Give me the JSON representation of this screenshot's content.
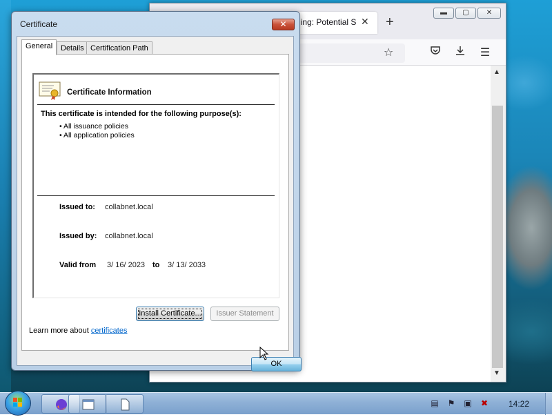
{
  "browser": {
    "tab_title": "ning: Potential S",
    "tab_close": "✕",
    "new_tab": "+",
    "window_controls": {
      "minimize": "▬",
      "maximize": "▢",
      "close": "✕"
    },
    "toolbar_icons": [
      "star-icon",
      "pocket-icon",
      "download-icon",
      "menu-icon"
    ]
  },
  "dialog": {
    "title": "Certificate",
    "close_label": "✕",
    "tabs": [
      {
        "label": "General",
        "active": true
      },
      {
        "label": "Details",
        "active": false
      },
      {
        "label": "Certification Path",
        "active": false
      }
    ],
    "info_heading": "Certificate Information",
    "purpose_heading": "This certificate is intended for the following purpose(s):",
    "purposes": [
      "• All issuance policies",
      "• All application policies"
    ],
    "issued_to_label": "Issued to:",
    "issued_to_value": "collabnet.local",
    "issued_by_label": "Issued by:",
    "issued_by_value": "collabnet.local",
    "valid_from_label": "Valid from",
    "valid_from_value": "3/ 16/ 2023",
    "valid_to_label": "to",
    "valid_to_value": "3/ 13/ 2033",
    "install_button": "Install Certificate...",
    "issuer_button": "Issuer Statement",
    "learn_more_text": "Learn more about",
    "learn_more_link": "certificates",
    "ok_button": "OK"
  },
  "taskbar": {
    "clock": "14:22",
    "apps": [
      "firefox-icon",
      "window-icon",
      "document-icon"
    ]
  },
  "colors": {
    "link": "#0066cc",
    "close_button": "#c9523a",
    "taskbar": "#8eb0d6"
  }
}
